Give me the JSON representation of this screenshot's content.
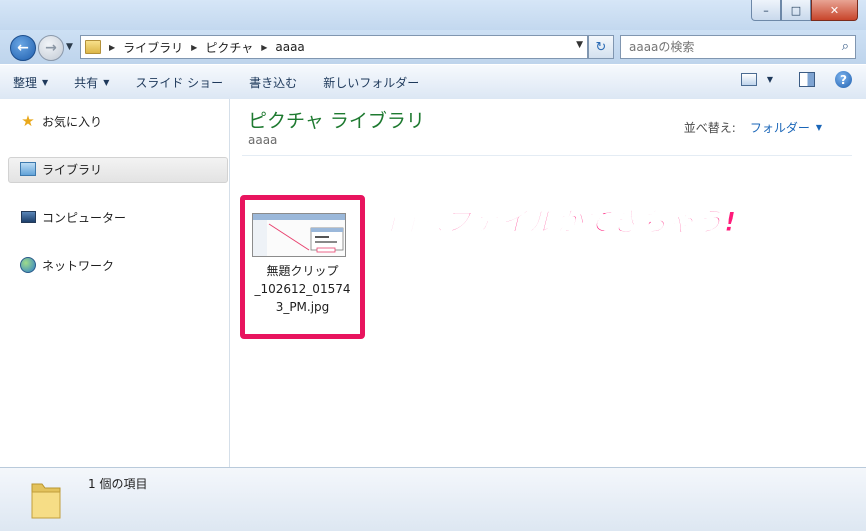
{
  "window": {
    "minimize": "–",
    "maximize": "□",
    "close": "✕"
  },
  "address": {
    "crumbs": [
      "ライブラリ",
      "ピクチャ",
      "aaaa"
    ],
    "search_placeholder": "aaaaの検索"
  },
  "commandbar": {
    "organize": "整理",
    "share": "共有",
    "slideshow": "スライド ショー",
    "burn": "書き込む",
    "new_folder": "新しいフォルダー"
  },
  "navpane": {
    "favorites": "お気に入り",
    "libraries": "ライブラリ",
    "computer": "コンピューター",
    "network": "ネットワーク"
  },
  "content": {
    "title": "ピクチャ ライブラリ",
    "subtitle": "aaaa",
    "sort_label": "並べ替え:",
    "sort_value": "フォルダー",
    "file": {
      "name_line1": "無題クリップ",
      "name_line2": "_102612_01574",
      "name_line3": "3_PM.jpg"
    }
  },
  "annotation": {
    "text": "画像ファイルができちゃう!",
    "color": "#ff1a7a"
  },
  "status": {
    "text": "1 個の項目"
  },
  "colors": {
    "highlight_border": "#e8145e",
    "library_title": "#1e7a30",
    "link_blue": "#1a66b8"
  }
}
